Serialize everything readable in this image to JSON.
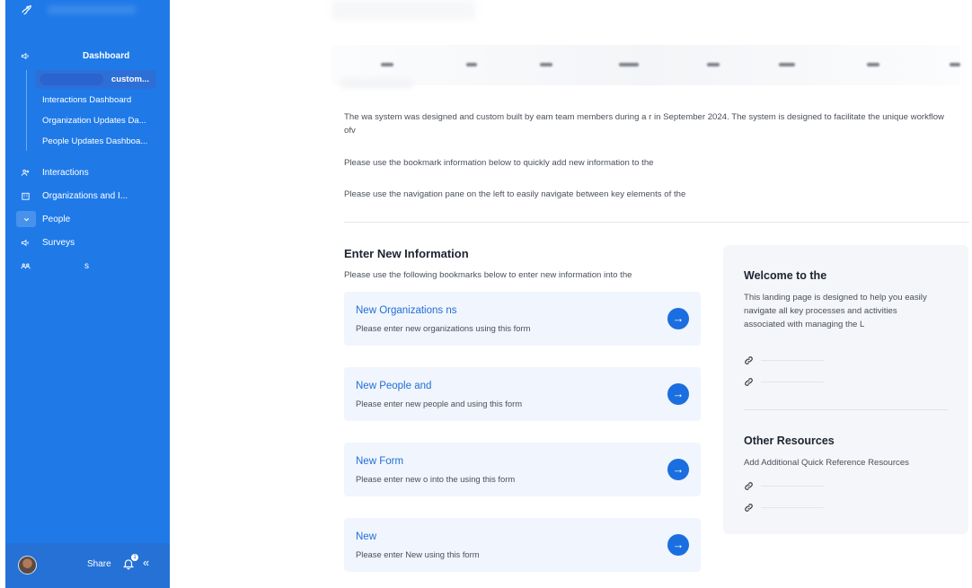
{
  "sidebar": {
    "dashboard": "Dashboard",
    "sub_items": [
      "custom...",
      "Interactions Dashboard",
      "Organization Updates Da...",
      "People Updates Dashboa..."
    ],
    "items": [
      "Interactions",
      "Organizations and I...",
      "People",
      "Surveys",
      "s"
    ],
    "footer": {
      "share": "Share",
      "notifications": "1"
    }
  },
  "main": {
    "intro": [
      "The wa       system was designed and custom built by               eam team members during a r                   in September 2024. The system is designed to facilitate the unique workflow ofv",
      "Please use the bookmark information below to quickly add new information to the",
      "Please use the navigation pane on the left to easily navigate between key elements of the"
    ],
    "section_title": "Enter New Information",
    "section_sub": "Please use the following bookmarks below to enter new information into the",
    "cards": [
      {
        "title": "New Organizations ns",
        "desc": "Please enter new organizations                      using this form"
      },
      {
        "title": "New People and",
        "desc": "Please enter new people and                  using this form"
      },
      {
        "title": "New                    Form",
        "desc": "Please enter new               o into the         using this form"
      },
      {
        "title": "New",
        "desc": "Please enter New                  using this form"
      }
    ]
  },
  "panel": {
    "welcome_title": "Welcome to the",
    "welcome_text": "This        landing page is designed to help you easily navigate all key processes and activities associated with managing the L",
    "other_title": "Other Resources",
    "other_text": "Add Additional Quick Reference Resources"
  },
  "colors": {
    "sidebar": "#1f7ae8",
    "accent": "#1a6ee0",
    "card_bg": "#f1f5fd"
  }
}
